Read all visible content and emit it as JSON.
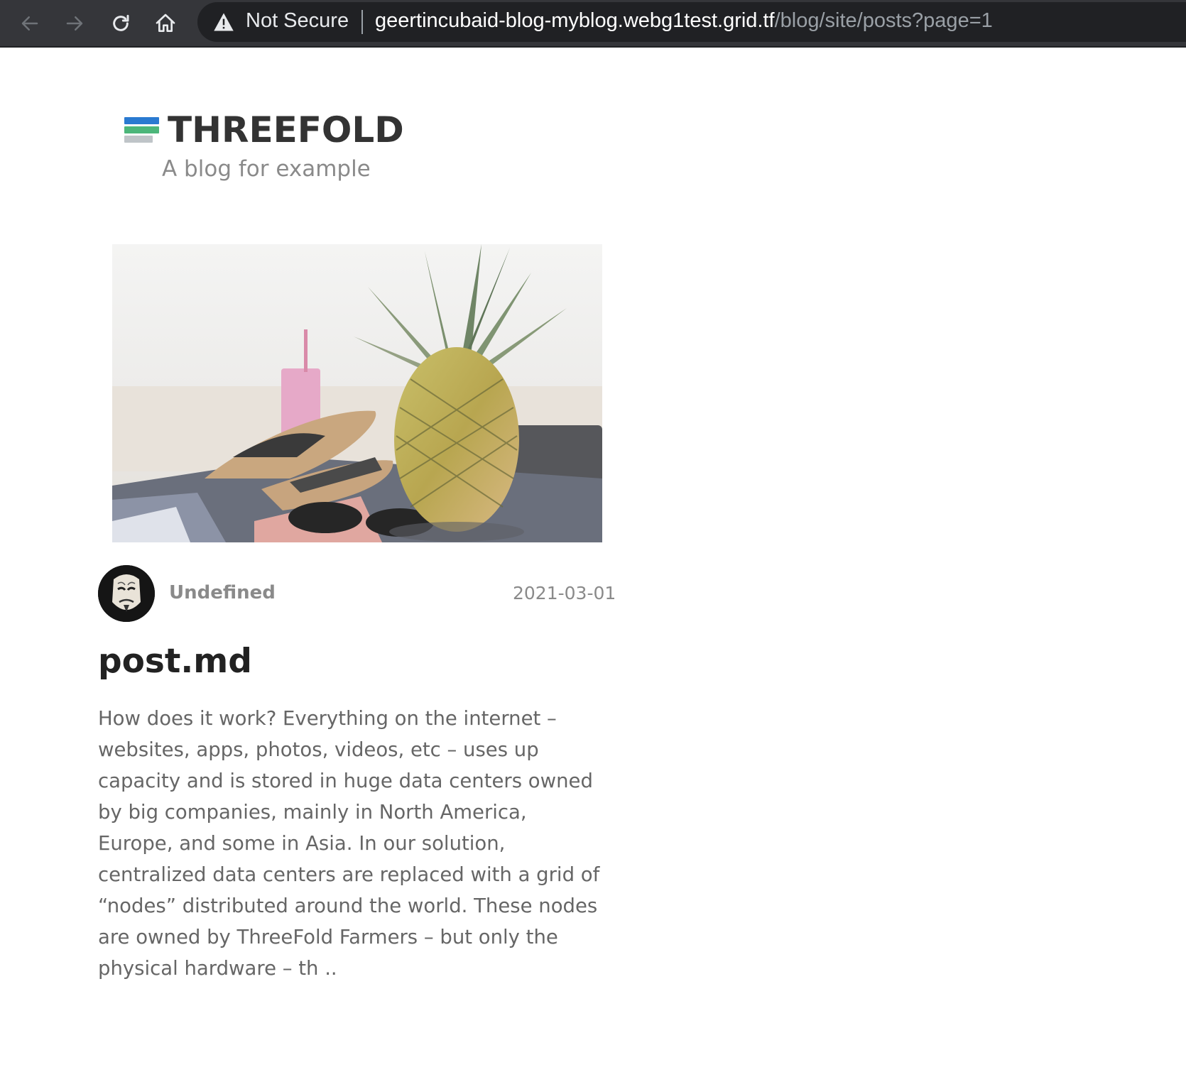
{
  "browser": {
    "security_label": "Not Secure",
    "url_host": "geertincubaid-blog-myblog.webg1test.grid.tf",
    "url_path": "/blog/site/posts?page=1",
    "icons": {
      "back": "arrow-left-icon",
      "forward": "arrow-right-icon",
      "reload": "reload-icon",
      "home": "home-icon",
      "warning": "warning-triangle-icon"
    }
  },
  "site": {
    "logo_text": "THREEFOLD",
    "tagline": "A blog for example",
    "colors": {
      "logo_blue": "#2a7ad1",
      "logo_green": "#4cb67a",
      "logo_gray": "#bfc4c8"
    }
  },
  "post": {
    "author": "Undefined",
    "date": "2021-03-01",
    "title": "post.md",
    "excerpt_lines": [
      "How does it work? Everything on the internet –",
      "websites, apps, photos, videos, etc – uses up",
      "capacity and is stored in huge data centers owned",
      "by big companies, mainly in North America,",
      "Europe, and some in Asia. In our solution,",
      "centralized data centers are replaced with a grid of",
      "“nodes” distributed around the world. These nodes",
      "are owned by ThreeFold Farmers – but only the",
      "physical hardware – th .."
    ]
  }
}
